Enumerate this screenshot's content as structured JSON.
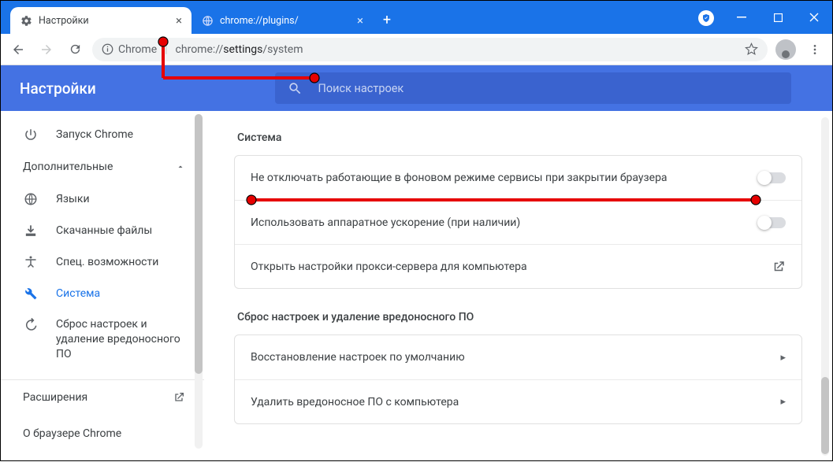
{
  "titlebar": {
    "tabs": [
      {
        "title": "Настройки"
      },
      {
        "title": "chrome://plugins/"
      }
    ]
  },
  "addressbar": {
    "secure_label": "Chrome",
    "url_host": "chrome://",
    "url_bold": "settings",
    "url_rest": "/system"
  },
  "header": {
    "app_title": "Настройки",
    "search_placeholder": "Поиск настроек"
  },
  "sidebar": {
    "items_top": [
      {
        "label": "Запуск Chrome"
      }
    ],
    "advanced_label": "Дополнительные",
    "items_adv": [
      {
        "label": "Языки"
      },
      {
        "label": "Скачанные файлы"
      },
      {
        "label": "Спец. возможности"
      },
      {
        "label": "Система"
      },
      {
        "label": "Сброс настроек и удаление вредоносного ПО"
      }
    ],
    "extensions": "Расширения",
    "about": "О браузере Chrome"
  },
  "main": {
    "section1_title": "Система",
    "section1_rows": [
      {
        "label": "Не отключать работающие в фоновом режиме сервисы при закрытии браузера"
      },
      {
        "label": "Использовать аппаратное ускорение (при наличии)"
      },
      {
        "label": "Открыть настройки прокси-сервера для компьютера"
      }
    ],
    "section2_title": "Сброс настроек и удаление вредоносного ПО",
    "section2_rows": [
      {
        "label": "Восстановление настроек по умолчанию"
      },
      {
        "label": "Удалить вредоносное ПО с компьютера"
      }
    ]
  }
}
